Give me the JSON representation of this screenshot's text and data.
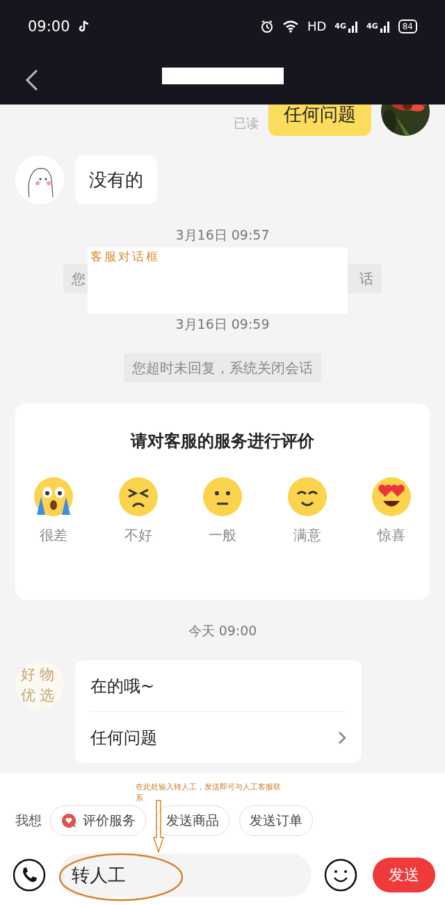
{
  "status_bar": {
    "time": "09:00",
    "hd": "HD",
    "networks": [
      "4G",
      "4G"
    ],
    "battery": "84"
  },
  "header": {
    "title_redacted": true
  },
  "messages": [
    {
      "kind": "own",
      "text": "任何问题",
      "read_label": "已读"
    },
    {
      "kind": "agent",
      "text": "没有的"
    },
    {
      "kind": "time",
      "text": "3月16日 09:57"
    },
    {
      "kind": "notice",
      "texts": [
        "您",
        "话"
      ],
      "redaction_label": "客服对话框"
    },
    {
      "kind": "time",
      "text": "3月16日 09:59"
    },
    {
      "kind": "notice",
      "texts": [
        "您超时未回复，系统关闭会话"
      ]
    },
    {
      "kind": "rating",
      "title": "请对客服的服务进行评价",
      "options": [
        {
          "kind": "crying",
          "label": "很差"
        },
        {
          "kind": "annoyed",
          "label": "不好"
        },
        {
          "kind": "neutral",
          "label": "一般"
        },
        {
          "kind": "smile",
          "label": "满意"
        },
        {
          "kind": "love",
          "label": "惊喜"
        }
      ]
    },
    {
      "kind": "time",
      "text": "今天 09:00"
    },
    {
      "kind": "menu",
      "avatar_text": [
        "好物",
        "优选"
      ],
      "items": [
        {
          "text": "在的哦~",
          "link": false
        },
        {
          "text": "任何问题",
          "link": true
        }
      ]
    }
  ],
  "quick_actions": {
    "label": "我想",
    "chips": [
      {
        "text": "评价服务",
        "icon": true
      },
      {
        "text": "发送商品",
        "icon": false
      },
      {
        "text": "发送订单",
        "icon": false
      }
    ]
  },
  "composer": {
    "value": "转人工",
    "send": "发送"
  },
  "annotation": {
    "text": "在此处输入转人工，发送即可与人工客服联系"
  }
}
